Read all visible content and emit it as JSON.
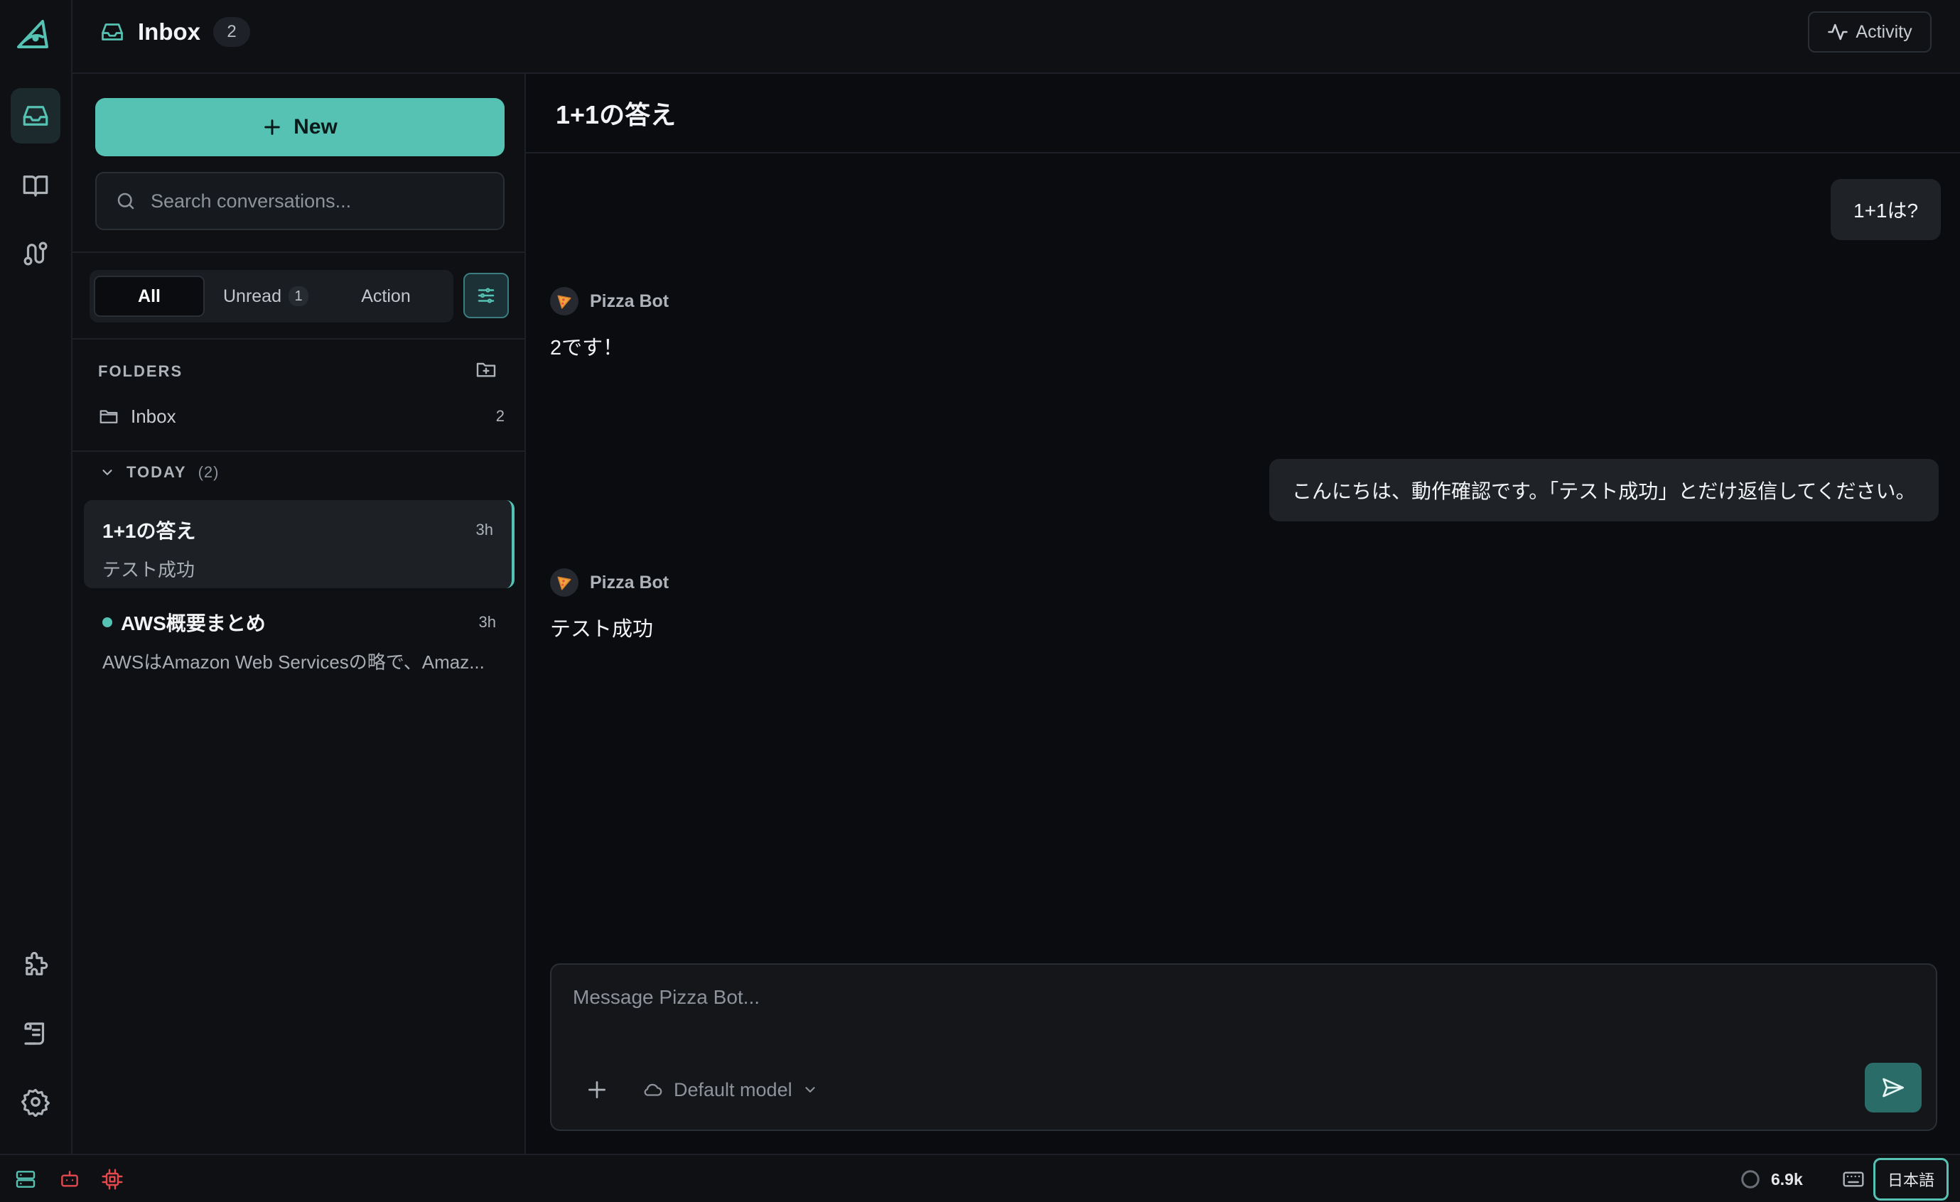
{
  "header": {
    "title": "Inbox",
    "badge": "2",
    "activity_label": "Activity"
  },
  "sidebar": {
    "new_label": "New",
    "search_placeholder": "Search conversations...",
    "filters": [
      {
        "label": "All",
        "active": true
      },
      {
        "label": "Unread",
        "count": "1"
      },
      {
        "label": "Action"
      }
    ],
    "folders_label": "FOLDERS",
    "folders": [
      {
        "name": "Inbox",
        "count": "2"
      }
    ],
    "group": {
      "label": "TODAY",
      "count": "(2)"
    },
    "conversations": [
      {
        "title": "1+1の答え",
        "time": "3h",
        "preview": "テスト成功",
        "selected": true,
        "unread": false
      },
      {
        "title": "AWS概要まとめ",
        "time": "3h",
        "preview": "AWSはAmazon Web Servicesの略で、Amaz...",
        "selected": false,
        "unread": true
      }
    ]
  },
  "chat": {
    "title": "1+1の答え",
    "messages": [
      {
        "role": "user",
        "text": "1+1は?"
      },
      {
        "role": "bot",
        "name": "Pizza Bot",
        "text": "2です！"
      },
      {
        "role": "user",
        "text": "こんにちは、動作確認です。「テスト成功」とだけ返信してください。"
      },
      {
        "role": "bot",
        "name": "Pizza Bot",
        "text": "テスト成功"
      }
    ],
    "composer_placeholder": "Message Pizza Bot...",
    "model_label": "Default model"
  },
  "status": {
    "tokens": "6.9k",
    "language": "日本語"
  },
  "colors": {
    "accent": "#55c2b3",
    "background": "#0b0c0f",
    "panel": "#0e1013",
    "danger": "#e5484d"
  }
}
